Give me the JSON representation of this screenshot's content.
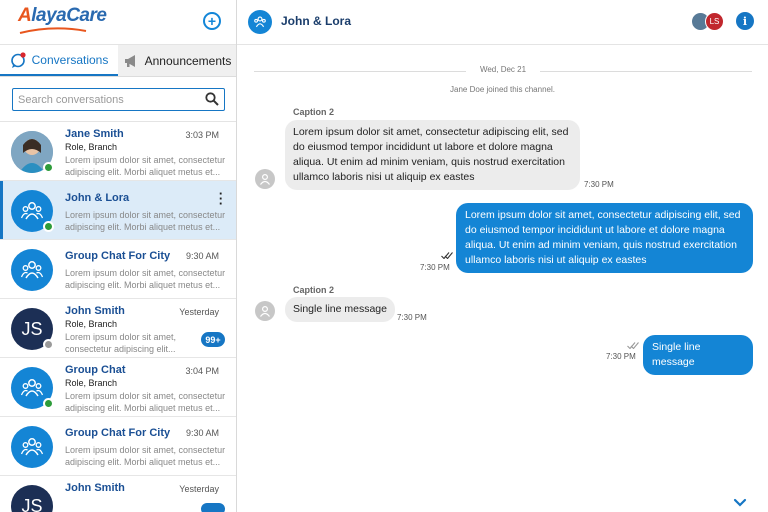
{
  "app": {
    "logo_text": "AlayaCare",
    "brand_blue": "#1676c4",
    "brand_orange": "#e8561e"
  },
  "sidebar": {
    "tabs": [
      {
        "label": "Conversations",
        "icon": "chat-bubble-icon",
        "active": true
      },
      {
        "label": "Announcements",
        "icon": "megaphone-icon",
        "active": false
      }
    ],
    "search": {
      "placeholder": "Search conversations",
      "value": ""
    },
    "conversations": [
      {
        "name": "Jane Smith",
        "time": "3:03 PM",
        "role": "Role, Branch",
        "preview": "Lorem ipsum dolor sit amet, consectetur adipiscing elit. Morbi aliquet metus et...",
        "avatar": "photo",
        "presence": "online"
      },
      {
        "name": "John & Lora",
        "time": "",
        "role": "",
        "preview": "Lorem ipsum dolor sit amet, consectetur adipiscing elit. Morbi aliquet metus et...",
        "avatar": "group",
        "presence": "online",
        "selected": true
      },
      {
        "name": "Group Chat For City",
        "time": "9:30 AM",
        "role": "",
        "preview": "Lorem ipsum dolor sit amet, consectetur adipiscing elit. Morbi aliquet metus et...",
        "avatar": "group",
        "presence": ""
      },
      {
        "name": "John Smith",
        "time": "Yesterday",
        "role": "Role, Branch",
        "preview": "Lorem ipsum dolor sit amet, consectetur adipiscing elit...",
        "avatar": "initials",
        "initials": "JS",
        "presence": "offline",
        "unread": "99+"
      },
      {
        "name": "Group Chat",
        "time": "3:04 PM",
        "role": "Role, Branch",
        "preview": "Lorem ipsum dolor sit amet, consectetur adipiscing elit. Morbi aliquet metus et...",
        "avatar": "group",
        "presence": "online"
      },
      {
        "name": "Group Chat For City",
        "time": "9:30 AM",
        "role": "",
        "preview": "Lorem ipsum dolor sit amet, consectetur adipiscing elit. Morbi aliquet metus et...",
        "avatar": "group",
        "presence": ""
      },
      {
        "name": "John Smith",
        "time": "Yesterday",
        "role": "",
        "preview": "",
        "avatar": "initials",
        "initials": "JS",
        "presence": ""
      }
    ]
  },
  "chat": {
    "title": "John & Lora",
    "participants": [
      {
        "initials": ""
      },
      {
        "initials": "LS"
      }
    ],
    "info_label": "i",
    "date": "Wed, Dec 21",
    "system_message": "Jane Doe joined this channel.",
    "messages": [
      {
        "direction": "in",
        "caption": "Caption 2",
        "text": "Lorem ipsum dolor sit amet, consectetur adipiscing elit, sed do eiusmod tempor incididunt ut labore et dolore magna aliqua. Ut enim ad minim veniam, quis nostrud exercitation ullamco laboris nisi ut aliquip ex eastes",
        "time": "7:30 PM"
      },
      {
        "direction": "out",
        "text": "Lorem ipsum dolor sit amet, consectetur adipiscing elit, sed do eiusmod tempor incididunt ut labore et dolore magna aliqua. Ut enim ad minim veniam, quis nostrud exercitation ullamco laboris nisi ut aliquip ex eastes",
        "time": "7:30 PM",
        "read": true
      },
      {
        "direction": "in",
        "caption": "Caption 2",
        "text": "Single line message",
        "time": "7:30 PM"
      },
      {
        "direction": "out",
        "text": "Single line message",
        "time": "7:30 PM",
        "read": true
      }
    ]
  }
}
